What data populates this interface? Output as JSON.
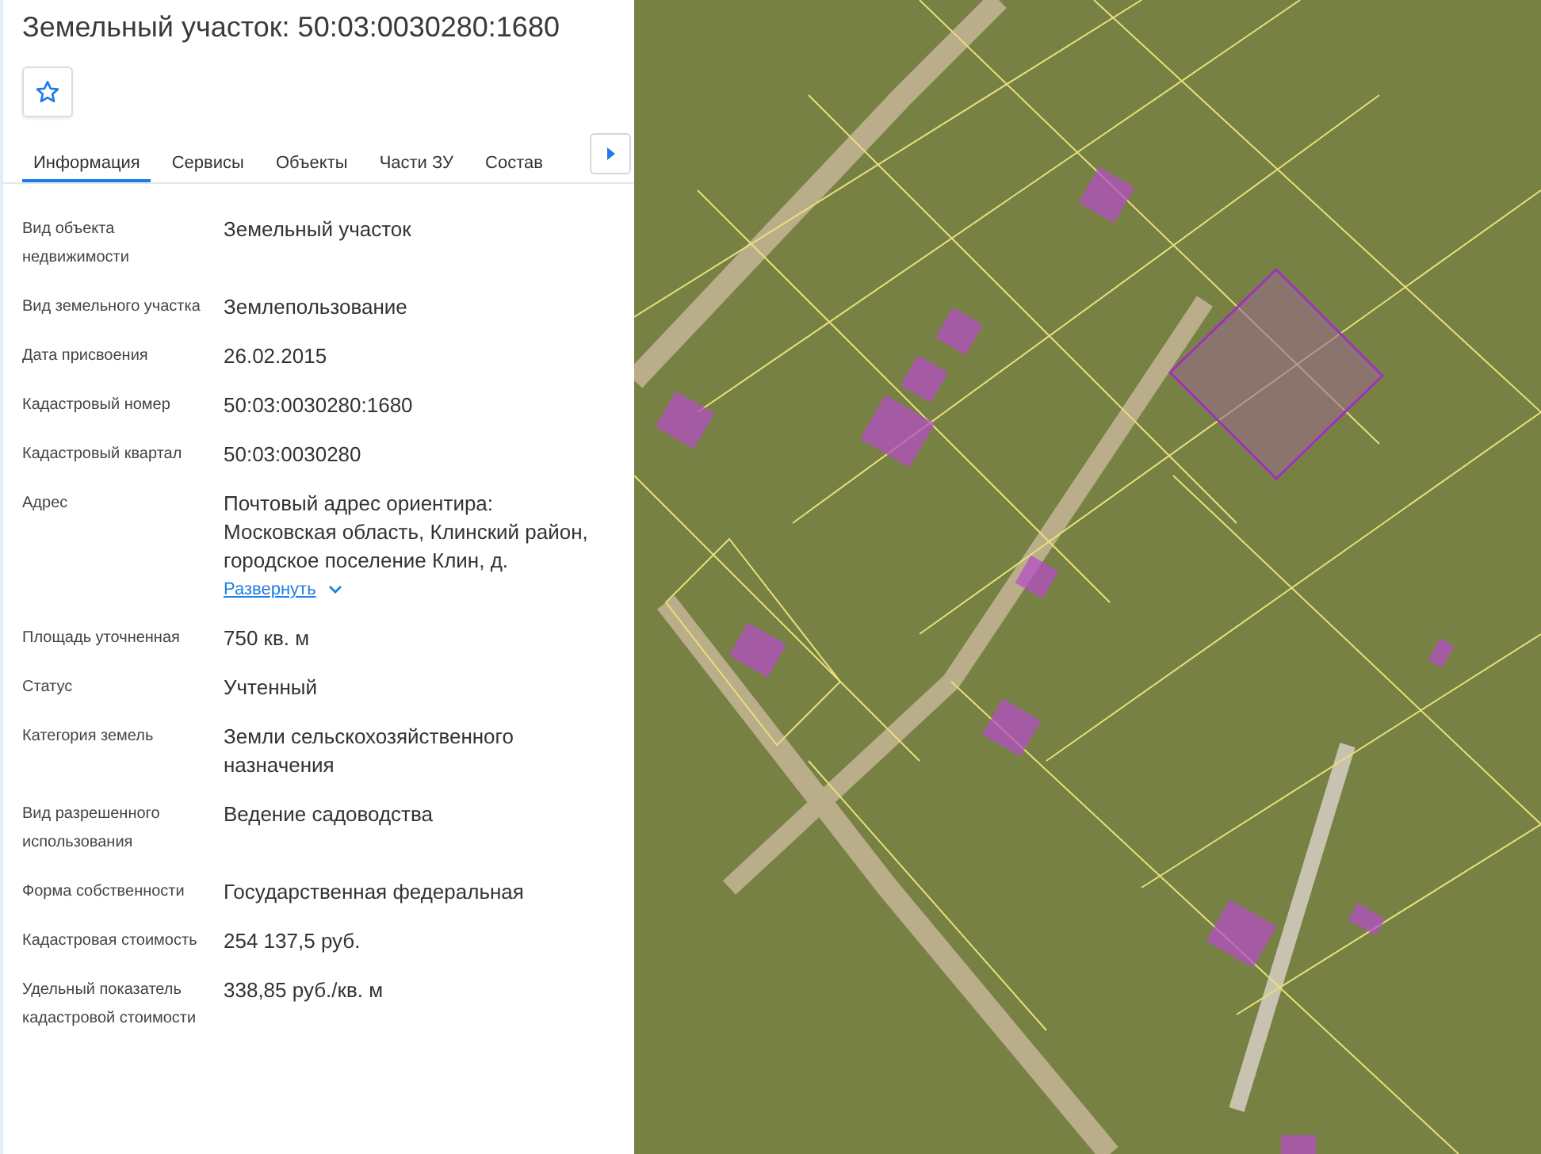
{
  "panel": {
    "title": "Земельный участок: 50:03:0030280:1680",
    "favorite": {
      "starred": false
    },
    "tabs": [
      {
        "label": "Информация",
        "selected": true
      },
      {
        "label": "Сервисы",
        "selected": false
      },
      {
        "label": "Объекты",
        "selected": false
      },
      {
        "label": "Части ЗУ",
        "selected": false
      },
      {
        "label": "Состав",
        "selected": false
      }
    ],
    "rows": [
      {
        "label": "Вид объекта недвижимости",
        "value": "Земельный участок"
      },
      {
        "label": "Вид земельного участка",
        "value": "Землепользование"
      },
      {
        "label": "Дата присвоения",
        "value": "26.02.2015"
      },
      {
        "label": "Кадастровый номер",
        "value": "50:03:0030280:1680"
      },
      {
        "label": "Кадастровый квартал",
        "value": "50:03:0030280"
      },
      {
        "label": "Адрес",
        "value": "Почтовый адрес ориентира: Московская область, Клинский район, городское поселение Клин, д.",
        "link": "Развернуть"
      },
      {
        "label": "Площадь уточненная",
        "value": "750 кв. м"
      },
      {
        "label": "Статус",
        "value": "Учтенный"
      },
      {
        "label": "Категория земель",
        "value": "Земли сельскохозяйственного назначения"
      },
      {
        "label": "Вид разрешенного использования",
        "value": "Ведение садоводства"
      },
      {
        "label": "Форма собственности",
        "value": "Государственная федеральная"
      },
      {
        "label": "Кадастровая стоимость",
        "value": "254 137,5 руб."
      },
      {
        "label": "Удельный показатель кадастровой стоимости",
        "value": "338,85 руб./кв. м"
      }
    ]
  }
}
